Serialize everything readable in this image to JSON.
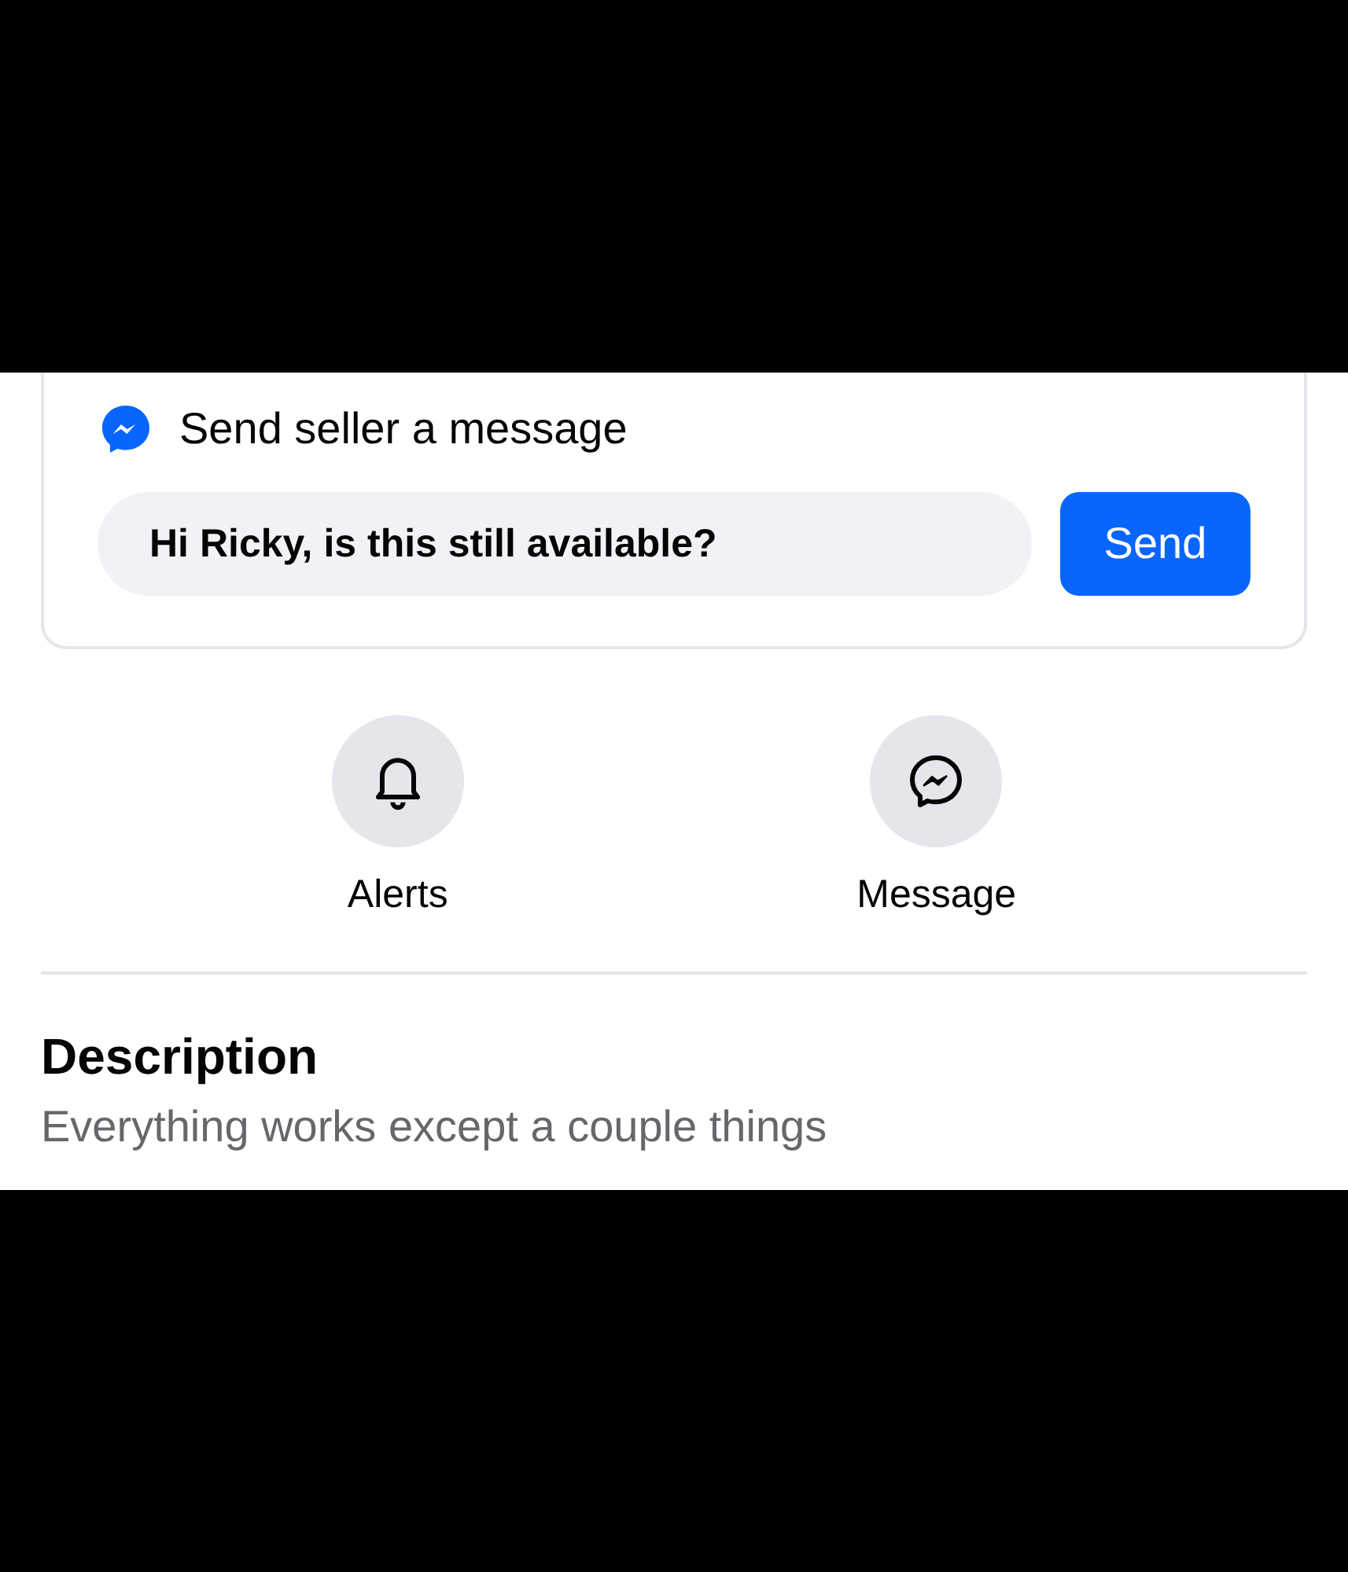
{
  "message_card": {
    "title": "Send seller a message",
    "input": {
      "value": "Hi Ricky, is this still available?"
    },
    "send_button": "Send"
  },
  "actions": [
    {
      "kind": "bell",
      "label": "Alerts"
    },
    {
      "kind": "messenger",
      "label": "Message"
    }
  ],
  "description": {
    "heading": "Description",
    "text": "Everything works except a couple things"
  }
}
